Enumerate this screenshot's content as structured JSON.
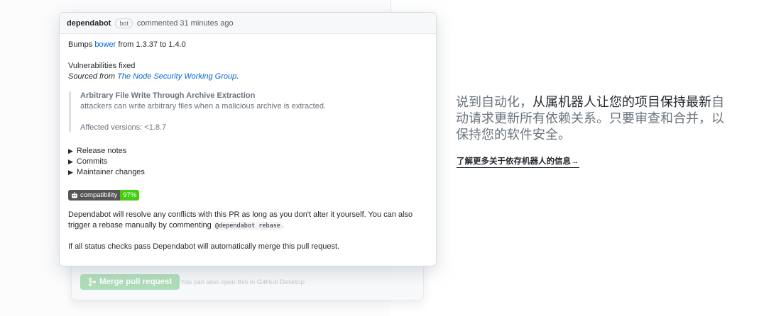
{
  "comment": {
    "author": "dependabot",
    "badge": "bot",
    "meta": "commented 31 minutes ago",
    "bumps_prefix": "Bumps",
    "bumps_pkg": "bower",
    "bumps_suffix": "from 1.3.37 to 1.4.0",
    "vuln_heading": "Vulnerabilities fixed",
    "sourced_prefix": "Sourced from",
    "sourced_link": "The Node Security Working Group",
    "sourced_end": ".",
    "quote_title": "Arbitrary File Write Through Archive Extraction",
    "quote_text": "attackers can write arbitrary files when a malicious archive is extracted.",
    "quote_affected": "Affected versions: <1.8.7",
    "details": [
      "Release notes",
      "Commits",
      "Maintainer changes"
    ],
    "compat_label": "compatibility",
    "compat_value": "97%",
    "resolve_line1": "Dependabot will resolve any conflicts with this PR as long as you don't alter it yourself. You can also",
    "resolve_line2_prefix": "trigger a rebase manually by commenting",
    "resolve_code": "@dependabot rebase",
    "resolve_line2_end": ".",
    "merge_note": "If all status checks pass Dependabot will automatically merge this pull request."
  },
  "merge_box": {
    "button": "Merge pull request",
    "hint": "You can also open this in GitHub Desktop"
  },
  "promo": {
    "headline_a": "说到自动化，",
    "headline_b": "从属机器人让您的项目保持最新",
    "headline_c": "自动请求更新所有依赖关系。只要审查和合并，以保持您的软件安全。",
    "link": "了解更多关于依存机器人的信息",
    "arrow": "→"
  },
  "colors": {
    "link": "#0366d6",
    "merge_button": "#94d3a2",
    "compat_green": "#44cc11",
    "compat_gray": "#555555"
  },
  "icons": [
    "git-merge-icon",
    "robot-icon",
    "triangle-right-icon",
    "arrow-right-icon"
  ]
}
